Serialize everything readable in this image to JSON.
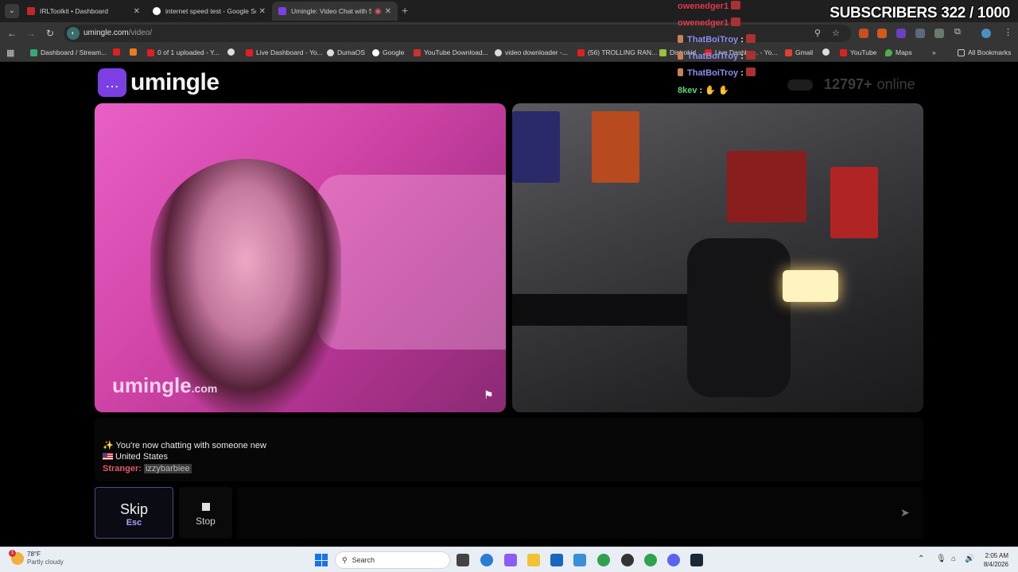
{
  "browser": {
    "tabs": [
      {
        "title": "IRLToolkit • Dashboard",
        "close": "✕"
      },
      {
        "title": "internet speed test - Google Se",
        "close": "✕"
      },
      {
        "title": "Umingle: Video Chat with S",
        "close": "✕"
      }
    ],
    "new_tab": "+",
    "url_host": "umingle.com",
    "url_path": "/video/",
    "bookmarks": [
      "Dashboard / Stream...",
      "0 of 1 uploaded - Y...",
      "Live Dashboard - Yo...",
      "DumaOS",
      "Google",
      "YouTube Download...",
      "video downloader -...",
      "(56) TROLLING RAN...",
      "Distrokid",
      "Live Dashbo... - Yo...",
      "Gmail",
      "YouTube",
      "Maps"
    ],
    "all_bookmarks": "All Bookmarks",
    "more_bookmarks": "»"
  },
  "site": {
    "logo_text": "umingle",
    "online_count": "12797+",
    "online_label": "online",
    "watermark_main": "umingle",
    "watermark_suffix": ".com"
  },
  "chat": {
    "line1": "✨ You're now chatting with someone new",
    "country": "United States",
    "stranger_label": "Stranger:",
    "stranger_name": "izzybarbiee"
  },
  "controls": {
    "skip_label": "Skip",
    "skip_key": "Esc",
    "stop_label": "Stop",
    "send_icon": "➤"
  },
  "overlay": {
    "subscribers": "SUBSCRIBERS 322 / 1000",
    "messages": [
      {
        "name": "owenedger1",
        "color": "#e0384a"
      },
      {
        "name": "owenedger1",
        "color": "#e0384a"
      },
      {
        "name": "ThatBoiTroy",
        "color": "#8a8ff0"
      },
      {
        "name": "ThatBoiTroy",
        "color": "#8a8ff0"
      },
      {
        "name": "ThatBoiTroy",
        "color": "#8a8ff0"
      },
      {
        "name": "8kev",
        "color": "#4cdf6a"
      }
    ],
    "separator": ":"
  },
  "taskbar": {
    "temp": "78°F",
    "weather": "Partly cloudy",
    "notification_count": "1",
    "search_label": "Search",
    "time": "2:05 AM",
    "date": "8/4/2026"
  },
  "colors": {
    "brand_purple": "#7b3fe4",
    "stranger_red": "#e05a6a",
    "skip_border": "#4b4b8b"
  }
}
